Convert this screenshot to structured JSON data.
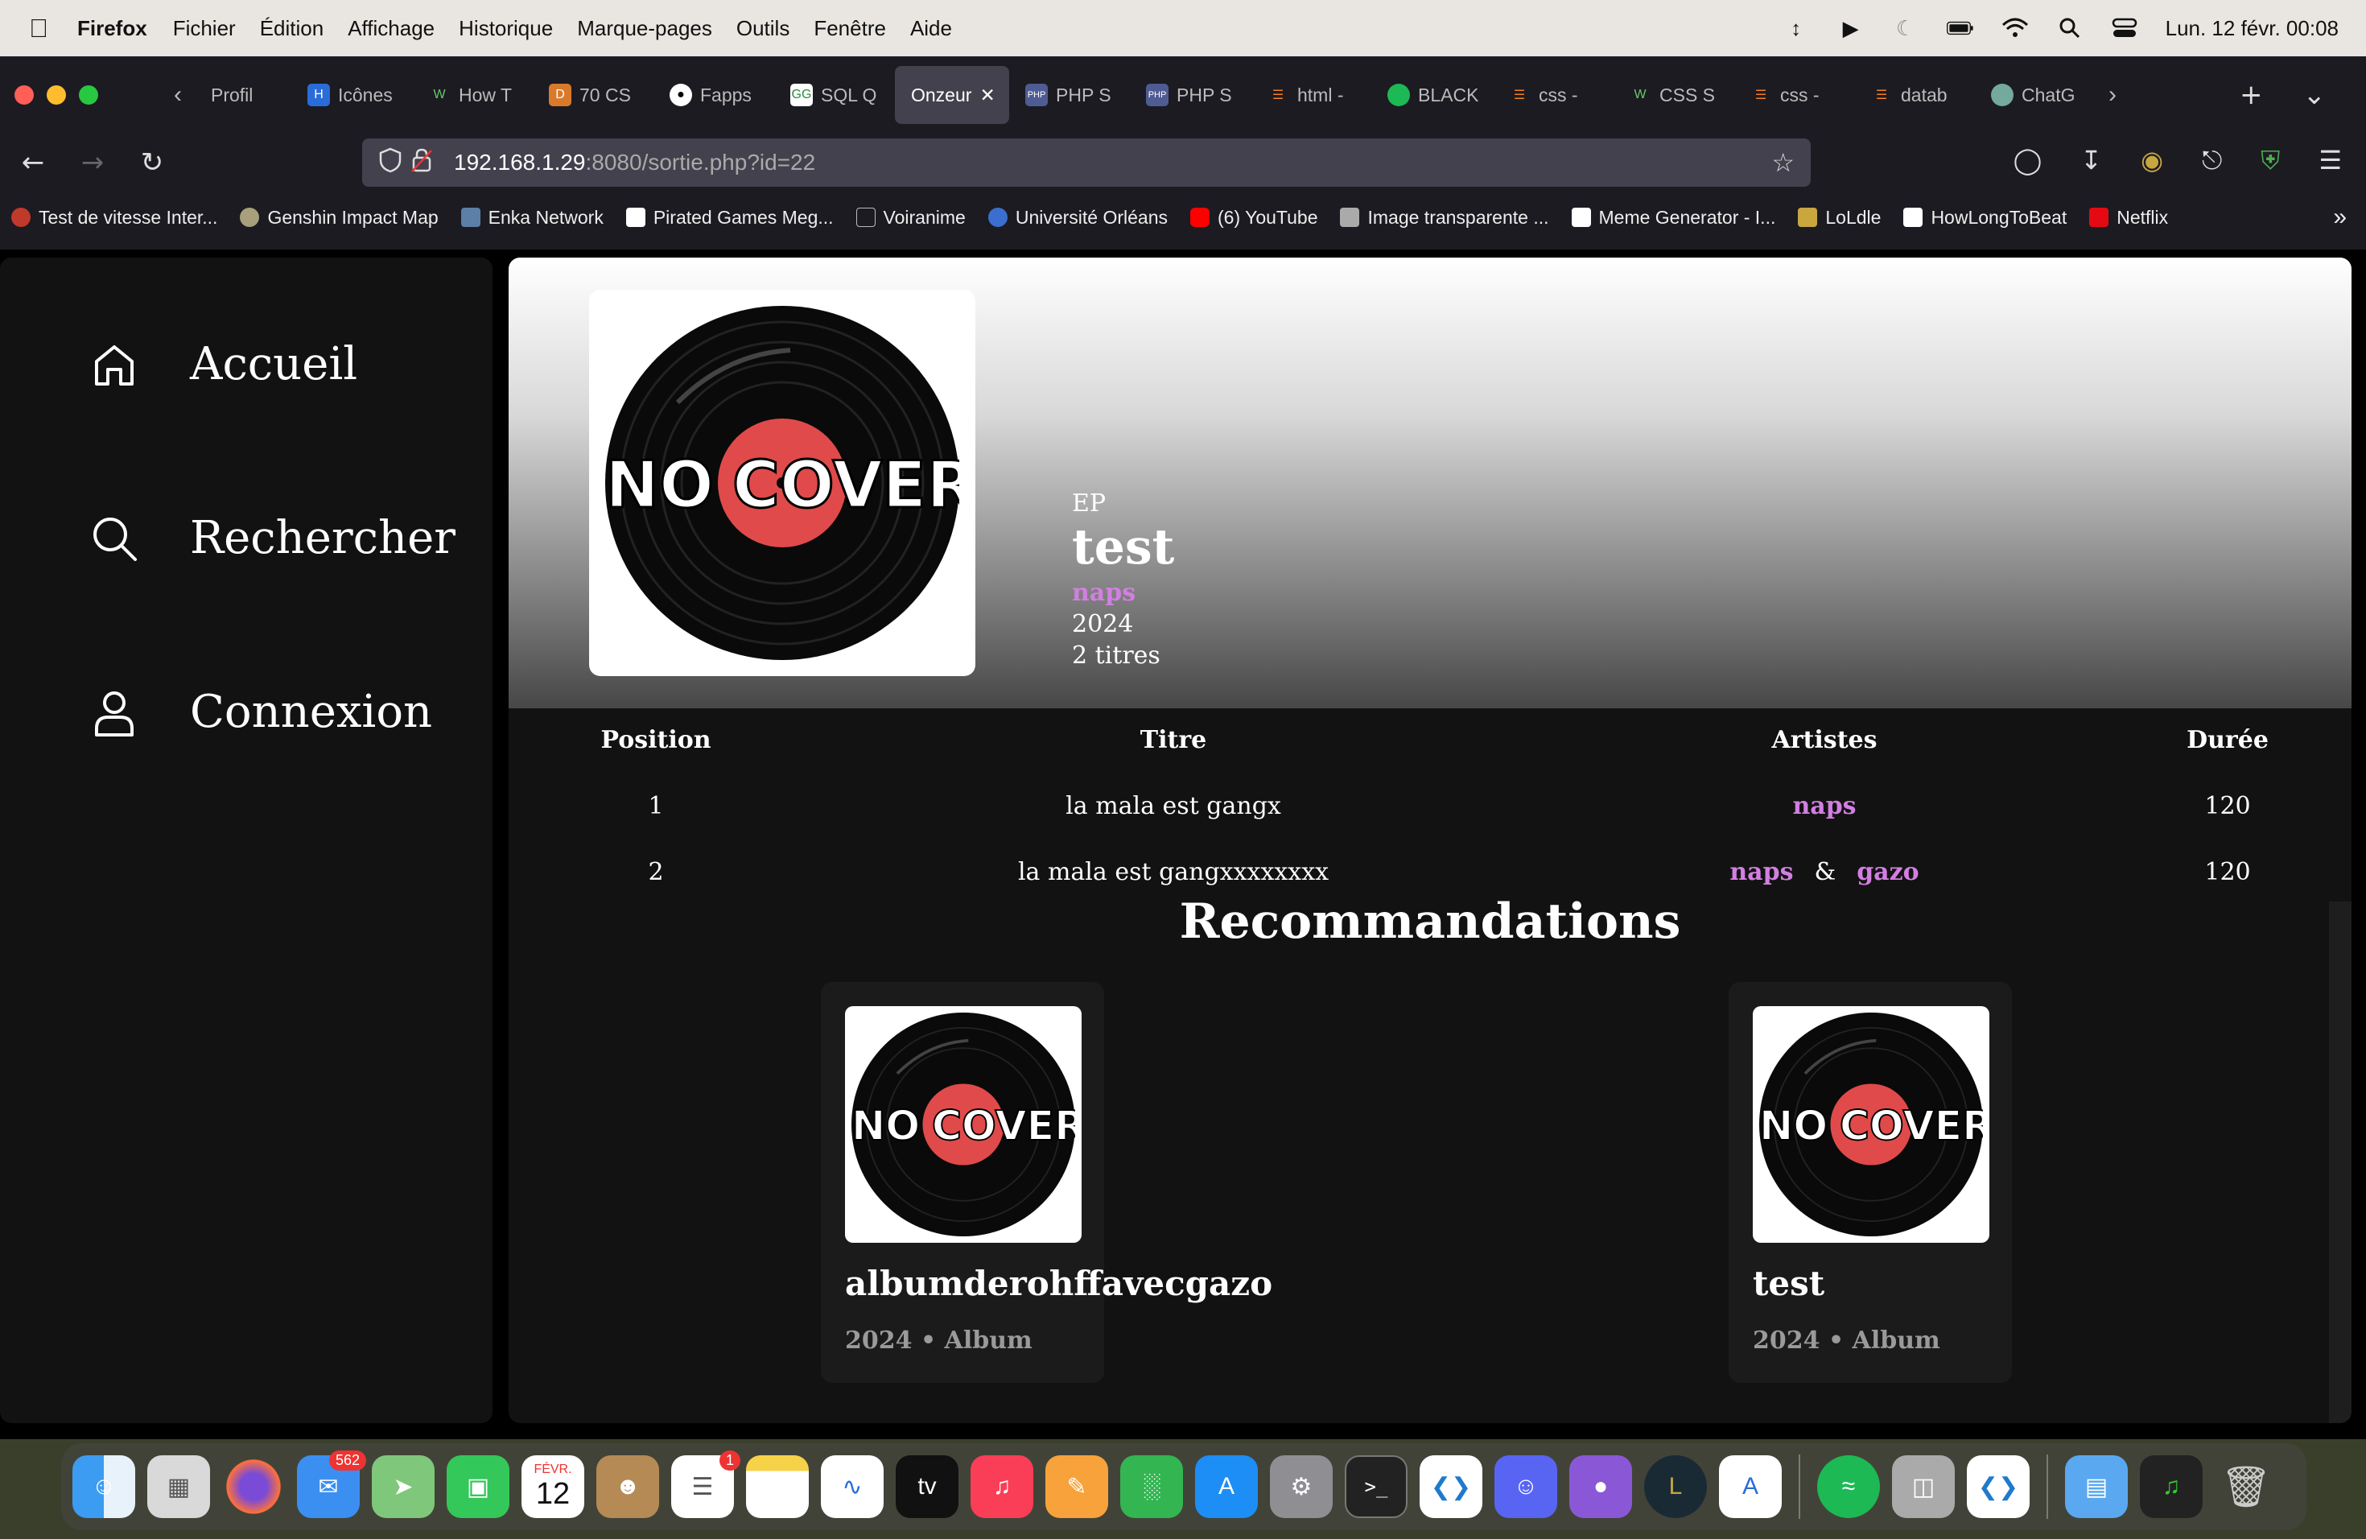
{
  "menubar": {
    "app": "Firefox",
    "items": [
      "Fichier",
      "Édition",
      "Affichage",
      "Historique",
      "Marque-pages",
      "Outils",
      "Fenêtre",
      "Aide"
    ],
    "clock": "Lun. 12 févr.  00:08"
  },
  "tabs": [
    {
      "label": "Profil"
    },
    {
      "label": "Icônes"
    },
    {
      "label": "How T"
    },
    {
      "label": "70 CS"
    },
    {
      "label": "Fapps"
    },
    {
      "label": "SQL Q"
    },
    {
      "label": "Onzeur"
    },
    {
      "label": "PHP S"
    },
    {
      "label": "PHP S"
    },
    {
      "label": "html -"
    },
    {
      "label": "BLACK"
    },
    {
      "label": "css -"
    },
    {
      "label": "CSS S"
    },
    {
      "label": "css -"
    },
    {
      "label": "datab"
    },
    {
      "label": "ChatG"
    }
  ],
  "url": {
    "host": "192.168.1.29",
    "rest": ":8080/sortie.php?id=22"
  },
  "bookmarks": [
    {
      "label": "Test de vitesse Inter..."
    },
    {
      "label": "Genshin Impact Map"
    },
    {
      "label": "Enka Network"
    },
    {
      "label": "Pirated Games Meg..."
    },
    {
      "label": "Voiranime"
    },
    {
      "label": "Université Orléans"
    },
    {
      "label": "(6) YouTube"
    },
    {
      "label": "Image transparente ..."
    },
    {
      "label": "Meme Generator - I..."
    },
    {
      "label": "LoLdle"
    },
    {
      "label": "HowLongToBeat"
    },
    {
      "label": "Netflix"
    }
  ],
  "sidebar": {
    "home": "Accueil",
    "search": "Rechercher",
    "login": "Connexion"
  },
  "release": {
    "cover_text_no": "NO",
    "cover_text_cover": "COVER",
    "type": "EP",
    "title": "test",
    "artist": "naps",
    "year": "2024",
    "track_count": "2 titres"
  },
  "tracklist": {
    "headers": {
      "position": "Position",
      "title": "Titre",
      "artists": "Artistes",
      "duration": "Durée"
    },
    "rows": [
      {
        "position": "1",
        "title": "la mala est gangx",
        "artists": [
          "naps"
        ],
        "duration": "120"
      },
      {
        "position": "2",
        "title": "la mala est gangxxxxxxxx",
        "artists": [
          "naps",
          "gazo"
        ],
        "duration": "120"
      }
    ],
    "separator": "&"
  },
  "recommendations": {
    "title": "Recommandations",
    "items": [
      {
        "title": "albumderohffavecgazo",
        "subtitle": "2024 • Album"
      },
      {
        "title": "test",
        "subtitle": "2024 • Album"
      }
    ]
  },
  "dock": {
    "mail_badge": "562",
    "calendar_month": "FÉVR.",
    "calendar_day": "12",
    "reminders_badge": "1",
    "tv_label": "tv"
  },
  "colors": {
    "accent_artist": "#d27fe2",
    "panel_bg": "#121212",
    "vinyl_red": "#e04a4a"
  }
}
